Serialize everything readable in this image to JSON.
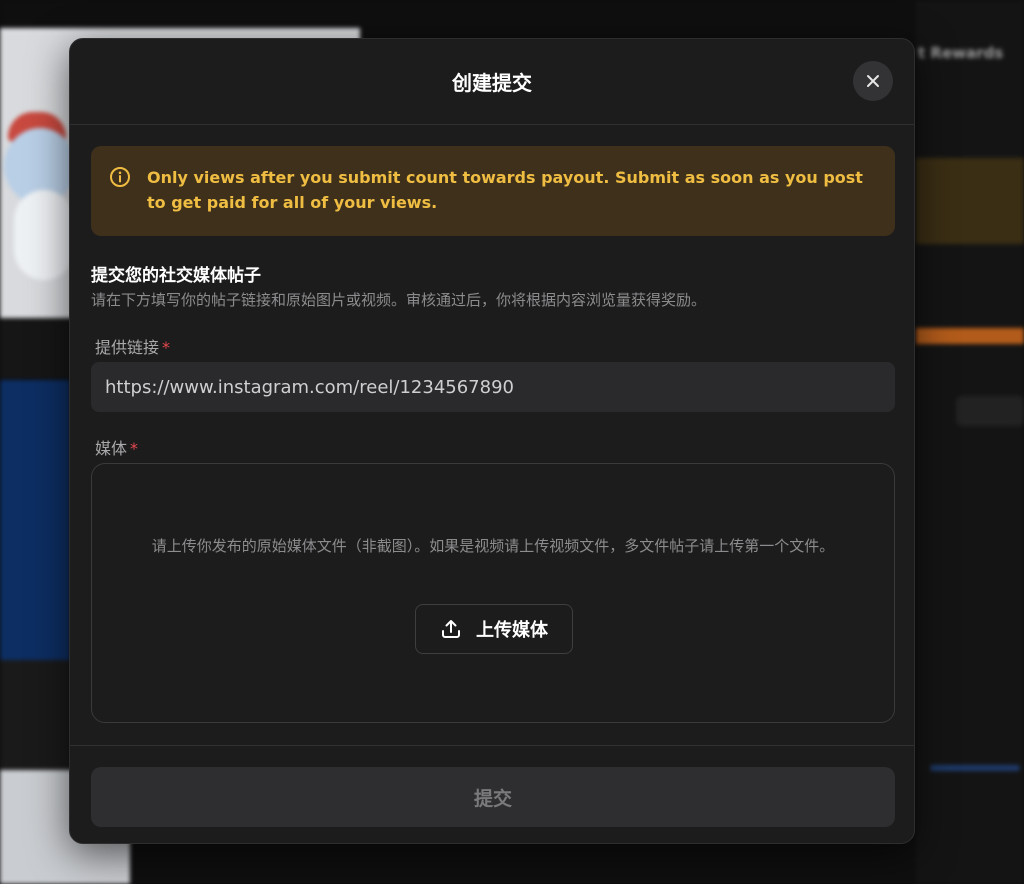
{
  "background": {
    "right_title": "t Rewards"
  },
  "modal": {
    "title": "创建提交",
    "close_icon": "close-icon",
    "notice": {
      "icon": "info-icon",
      "text": "Only views after you submit count towards payout. Submit as soon as you post to get paid for all of your views.",
      "color": "#f0bd43"
    },
    "section": {
      "title": "提交您的社交媒体帖子",
      "description": "请在下方填写你的帖子链接和原始图片或视频。审核通过后，你将根据内容浏览量获得奖励。"
    },
    "link_field": {
      "label": "提供链接",
      "required_mark": "*",
      "value": "https://www.instagram.com/reel/1234567890"
    },
    "media_field": {
      "label": "媒体",
      "required_mark": "*",
      "hint": "请上传你发布的原始媒体文件（非截图）。如果是视频请上传视频文件，多文件帖子请上传第一个文件。",
      "upload_button": "上传媒体",
      "upload_icon": "upload-icon"
    },
    "submit_button": "提交"
  }
}
